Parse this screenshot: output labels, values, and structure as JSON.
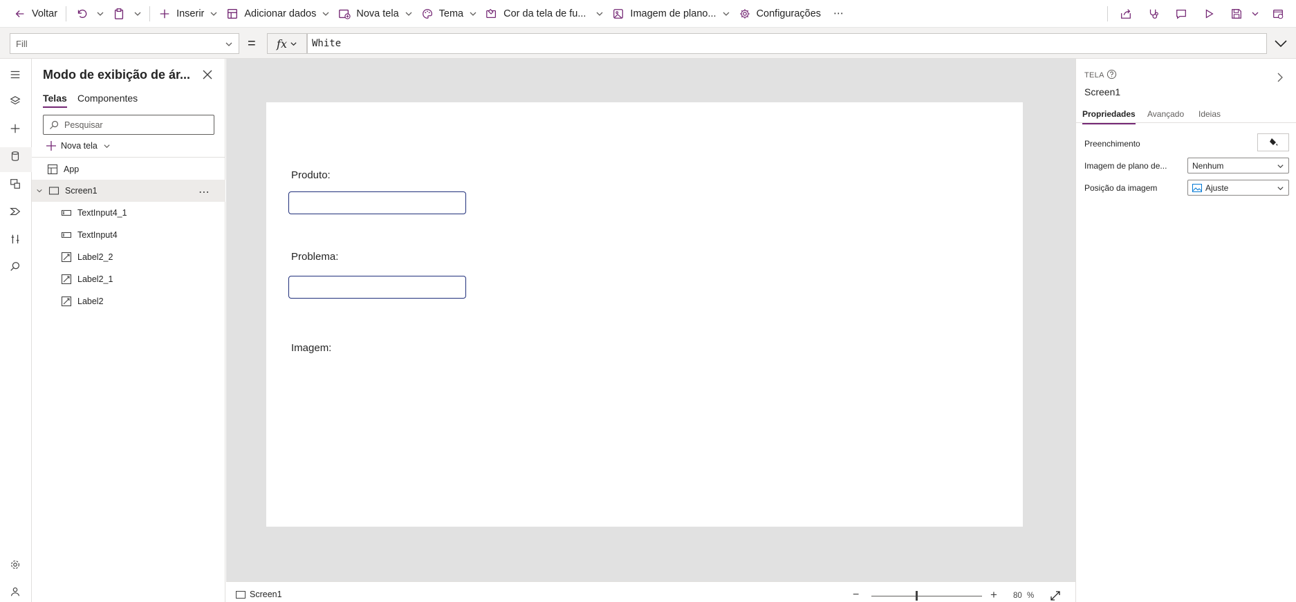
{
  "colors": {
    "accent": "#742774",
    "canvas_bg": "#e1e1e1",
    "input_border": "#1f2e7a"
  },
  "commandbar": {
    "back_label": "Voltar",
    "insert_label": "Inserir",
    "add_data_label": "Adicionar dados",
    "new_screen_label": "Nova tela",
    "theme_label": "Tema",
    "background_color_label": "Cor da tela de fu...",
    "background_image_label": "Imagem de plano...",
    "settings_label": "Configurações",
    "more_label": "⋯"
  },
  "formula": {
    "property": "Fill",
    "equals": "=",
    "fx": "fx",
    "value": "White"
  },
  "tree": {
    "title": "Modo de exibição de ár...",
    "tabs": [
      "Telas",
      "Componentes"
    ],
    "search_placeholder": "Pesquisar",
    "new_screen_label": "Nova tela",
    "items": [
      {
        "label": "App",
        "icon": "app-icon"
      },
      {
        "label": "Screen1",
        "icon": "screen-icon"
      },
      {
        "label": "TextInput4_1",
        "icon": "text-input-icon"
      },
      {
        "label": "TextInput4",
        "icon": "text-input-icon"
      },
      {
        "label": "Label2_2",
        "icon": "label-icon"
      },
      {
        "label": "Label2_1",
        "icon": "label-icon"
      },
      {
        "label": "Label2",
        "icon": "label-icon"
      }
    ],
    "row_more": "⋯"
  },
  "canvas": {
    "labels": [
      "Produto:",
      "Problema:",
      "Imagem:"
    ]
  },
  "status": {
    "screen_name": "Screen1",
    "zoom_minus": "−",
    "zoom_plus": "+",
    "zoom_value": "80",
    "zoom_unit": "%"
  },
  "properties": {
    "kind": "TELA",
    "name": "Screen1",
    "tabs": [
      "Propriedades",
      "Avançado",
      "Ideias"
    ],
    "fill_label": "Preenchimento",
    "bg_image_label": "Imagem de plano de...",
    "bg_image_value": "Nenhum",
    "image_position_label": "Posição da imagem",
    "image_position_value": "Ajuste"
  }
}
